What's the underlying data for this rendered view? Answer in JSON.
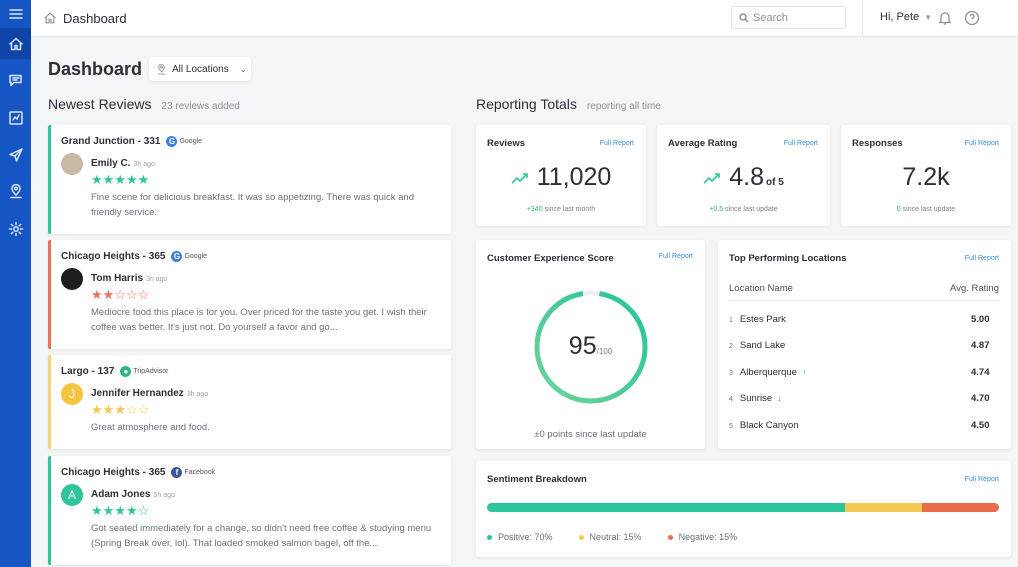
{
  "header": {
    "breadcrumb": "Dashboard",
    "search_placeholder": "Search",
    "user_greeting": "Hi, Pete"
  },
  "sidebar": {
    "items": [
      {
        "icon": "menu-icon"
      },
      {
        "icon": "home-icon",
        "active": true
      },
      {
        "icon": "reviews-icon"
      },
      {
        "icon": "reports-icon"
      },
      {
        "icon": "send-icon"
      },
      {
        "icon": "location-icon"
      },
      {
        "icon": "gear-icon"
      }
    ]
  },
  "page": {
    "title": "Dashboard",
    "location_filter": "All Locations"
  },
  "reviews_section": {
    "title": "Newest Reviews",
    "subtitle": "23 reviews added",
    "reviews": [
      {
        "location": "Grand Junction - 331",
        "source": "Google",
        "source_color": "#3a7fd9",
        "reviewer": "Emily C.",
        "ago": "3h ago",
        "rating": 5,
        "star_color": "#2fc59a",
        "border_color": "#2fc59a",
        "avatar_initial": "",
        "avatar_color": "#c9b8a6",
        "text": "Fine scene for delicious breakfast. It was so appetizing. There was quick and friendly service."
      },
      {
        "location": "Chicago Heights - 365",
        "source": "Google",
        "source_color": "#3a7fd9",
        "reviewer": "Tom Harris",
        "ago": "3h ago",
        "rating": 2,
        "star_color": "#e8735a",
        "border_color": "#e8735a",
        "avatar_initial": "",
        "avatar_color": "#1f1f1f",
        "text": "Mediocre food this place is for you. Over priced for the taste you get. I wish their coffee was better. It's just not. Do yourself a favor and go..."
      },
      {
        "location": "Largo - 137",
        "source": "TripAdvisor",
        "source_color": "#2fb58a",
        "reviewer": "Jennifer Hernandez",
        "ago": "3h ago",
        "rating": 3,
        "star_color": "#f3c94f",
        "border_color": "#f3d57a",
        "avatar_initial": "J",
        "avatar_color": "#f5c542",
        "text": "Great atmosphere and food."
      },
      {
        "location": "Chicago Heights - 365",
        "source": "Facebook",
        "source_color": "#3b5998",
        "reviewer": "Adam Jones",
        "ago": "5h ago",
        "rating": 4,
        "star_color": "#2fc59a",
        "border_color": "#2fc59a",
        "avatar_initial": "A",
        "avatar_color": "#2fc59a",
        "text": "Got seated immediately for a change, so didn't need free coffee & studying menu (Spring Break over, lol). That loaded smoked salmon bagel, off the..."
      }
    ]
  },
  "reporting": {
    "title": "Reporting Totals",
    "subtitle": "reporting all time",
    "full_report_label": "Full Report",
    "reviews": {
      "title": "Reviews",
      "value": "11,020",
      "delta": "+340",
      "delta_text": "since last month"
    },
    "average_rating": {
      "title": "Average Rating",
      "value": "4.8",
      "suffix": "of 5",
      "delta": "+0.5",
      "delta_text": "since last update"
    },
    "responses": {
      "title": "Responses",
      "value": "7.2k",
      "delta": "0",
      "delta_text": "since last update"
    },
    "cx_score": {
      "title": "Customer Experience Score",
      "value": "95",
      "max": "/100",
      "fraction": 0.95,
      "delta_text": "±0 points since last update"
    },
    "top_locations": {
      "title": "Top Performing Locations",
      "col_name": "Location Name",
      "col_rating": "Avg. Rating",
      "rows": [
        {
          "rank": "1",
          "name": "Estes Park",
          "rating": "5.00",
          "trend": ""
        },
        {
          "rank": "2",
          "name": "Sand Lake",
          "rating": "4.87",
          "trend": ""
        },
        {
          "rank": "3",
          "name": "Alberquerque",
          "rating": "4.74",
          "trend": "up"
        },
        {
          "rank": "4",
          "name": "Sunrise",
          "rating": "4.70",
          "trend": "down"
        },
        {
          "rank": "5",
          "name": "Black Canyon",
          "rating": "4.50",
          "trend": ""
        }
      ]
    },
    "sentiment": {
      "title": "Sentiment Breakdown",
      "segments": [
        {
          "label": "Positive: 70%",
          "percent": 70,
          "color": "#2fc59a"
        },
        {
          "label": "Neutral: 15%",
          "percent": 15,
          "color": "#f3c94f"
        },
        {
          "label": "Negative: 15%",
          "percent": 15,
          "color": "#ec6a4c"
        }
      ]
    }
  },
  "colors": {
    "sidebar": "#1655c4",
    "accent_green": "#2fc59a",
    "link_blue": "#3a8fd6"
  }
}
